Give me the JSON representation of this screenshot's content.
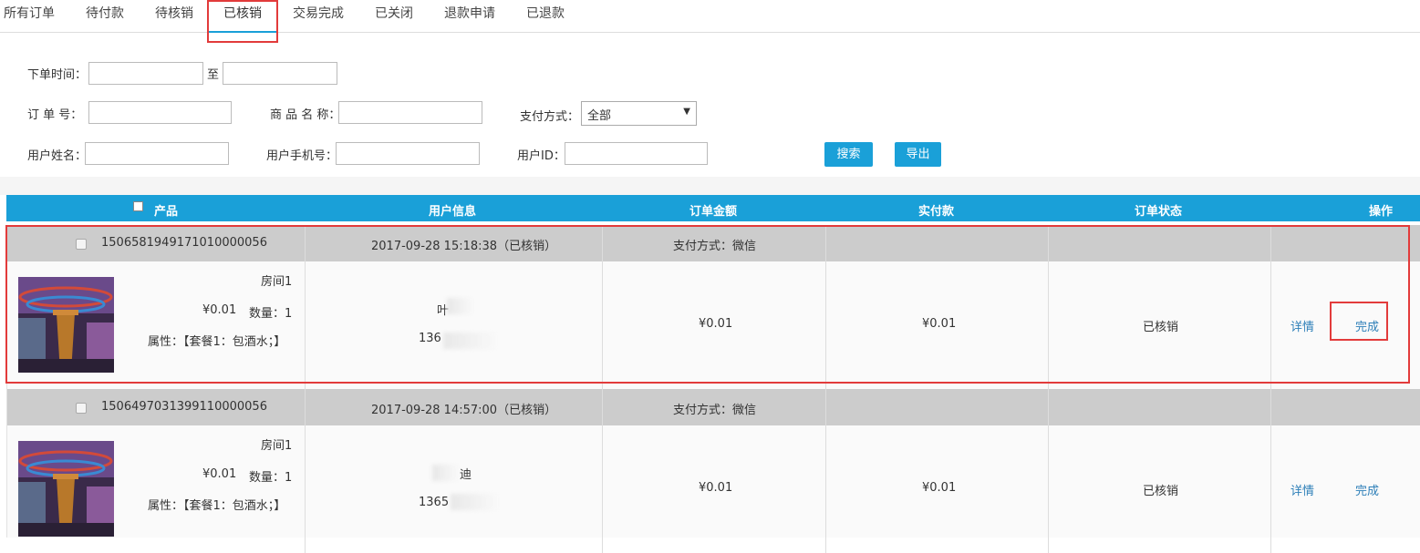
{
  "tabs": [
    "所有订单",
    "待付款",
    "待核销",
    "已核销",
    "交易完成",
    "已关闭",
    "退款申请",
    "已退款"
  ],
  "active_tab": "已核销",
  "filters": {
    "order_time_label": "下单时间：",
    "to_label": "至",
    "order_no_label": "订 单 号：",
    "product_name_label": "商 品 名 称：",
    "pay_method_label": "支付方式：",
    "pay_method_value": "全部",
    "user_name_label": "用户姓名：",
    "user_phone_label": "用户手机号：",
    "user_id_label": "用户ID：",
    "search_btn": "搜索",
    "export_btn": "导出"
  },
  "table": {
    "headers": {
      "product": "产品",
      "user_info": "用户信息",
      "order_amount": "订单金额",
      "paid": "实付款",
      "status": "订单状态",
      "actions": "操作"
    }
  },
  "orders": [
    {
      "order_no": "1506581949171010000056",
      "time_status": "2017-09-28 15:18:38（已核销）",
      "pay_method": "支付方式：微信",
      "product_name": "房间1",
      "price": "¥0.01",
      "qty": "数量：1",
      "attrs": "属性：【套餐1：包酒水；】",
      "user_name": "叶",
      "user_phone": "136",
      "order_amount": "¥0.01",
      "paid": "¥0.01",
      "status": "已核销",
      "detail_link": "详情",
      "done_link": "完成"
    },
    {
      "order_no": "1506497031399110000056",
      "time_status": "2017-09-28 14:57:00（已核销）",
      "pay_method": "支付方式：微信",
      "product_name": "房间1",
      "price": "¥0.01",
      "qty": "数量：1",
      "attrs": "属性：【套餐1：包酒水；】",
      "user_name": "迪",
      "user_phone": "1365",
      "order_amount": "¥0.01",
      "paid": "¥0.01",
      "status": "已核销",
      "detail_link": "详情",
      "done_link": "完成"
    }
  ]
}
